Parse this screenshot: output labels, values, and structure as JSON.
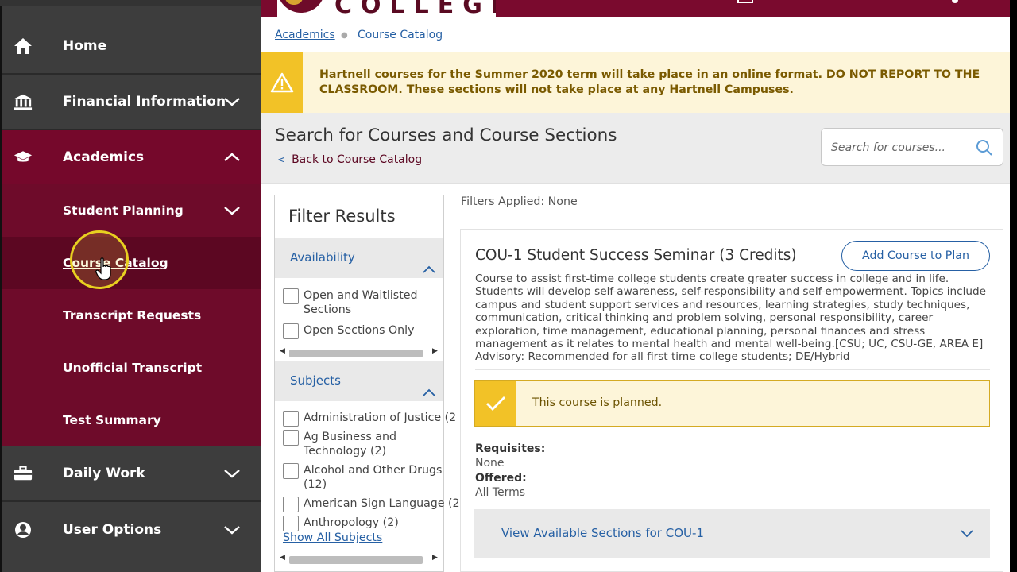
{
  "sidebar": {
    "items": [
      {
        "label": "Home",
        "icon": "home-icon"
      },
      {
        "label": "Financial Information",
        "icon": "bank-icon"
      },
      {
        "label": "Academics",
        "icon": "graduation-cap-icon"
      },
      {
        "label": "Daily Work",
        "icon": "briefcase-icon"
      },
      {
        "label": "User Options",
        "icon": "user-icon"
      }
    ],
    "academics_sub": [
      {
        "label": "Student Planning"
      },
      {
        "label": "Course Catalog"
      },
      {
        "label": "Transcript Requests"
      },
      {
        "label": "Unofficial Transcript"
      },
      {
        "label": "Test Summary"
      }
    ]
  },
  "header": {
    "logo_text": "COLLEGE"
  },
  "breadcrumb": {
    "root": "Academics",
    "current": "Course Catalog"
  },
  "alert": {
    "text": "Hartnell courses for the Summer 2020 term will take place in an online format. DO NOT REPORT TO THE CLASSROOM. These sections will not take place at any Hartnell Campuses."
  },
  "page": {
    "title": "Search for Courses and Course Sections",
    "back_link": "Back to Course Catalog",
    "search_placeholder": "Search for courses..."
  },
  "filter": {
    "title": "Filter Results",
    "availability": {
      "label": "Availability",
      "options": [
        "Open and Waitlisted Sections",
        "Open Sections Only"
      ]
    },
    "subjects": {
      "label": "Subjects",
      "options": [
        "Administration of Justice (2",
        "Ag Business and Technology (2)",
        "Alcohol and Other Drugs (12)",
        "American Sign Language (2",
        "Anthropology (2)"
      ],
      "show_all": "Show All Subjects"
    }
  },
  "results": {
    "filters_applied": "Filters Applied: None",
    "course": {
      "title": "COU-1 Student Success Seminar (3 Credits)",
      "add_button": "Add Course to Plan",
      "description": "Course to assist first-time college students create greater success in college and in life. Students will develop self-awareness, self-responsibility and self-empowerment. Topics include campus and student support services and resources, learning strategies, study techniques, communication, critical thinking and problem solving, personal responsibility, career exploration, time management, educational planning, personal finances and stress management as it relates to mental health and mental well-being.[CSU; UC, CSU-GE, AREA E] Advisory: Recommended for all first time college students; DE/Hybrid",
      "planned_status": "This course is planned.",
      "requisites_label": "Requisites:",
      "requisites_value": "None",
      "offered_label": "Offered:",
      "offered_value": "All Terms",
      "sections_link": "View Available Sections for COU-1"
    }
  },
  "colors": {
    "maroon": "#6e0b2a",
    "sidebar_bg": "#3d3d3d",
    "link_blue": "#2660a4",
    "alert_yellow": "#f2c227"
  }
}
